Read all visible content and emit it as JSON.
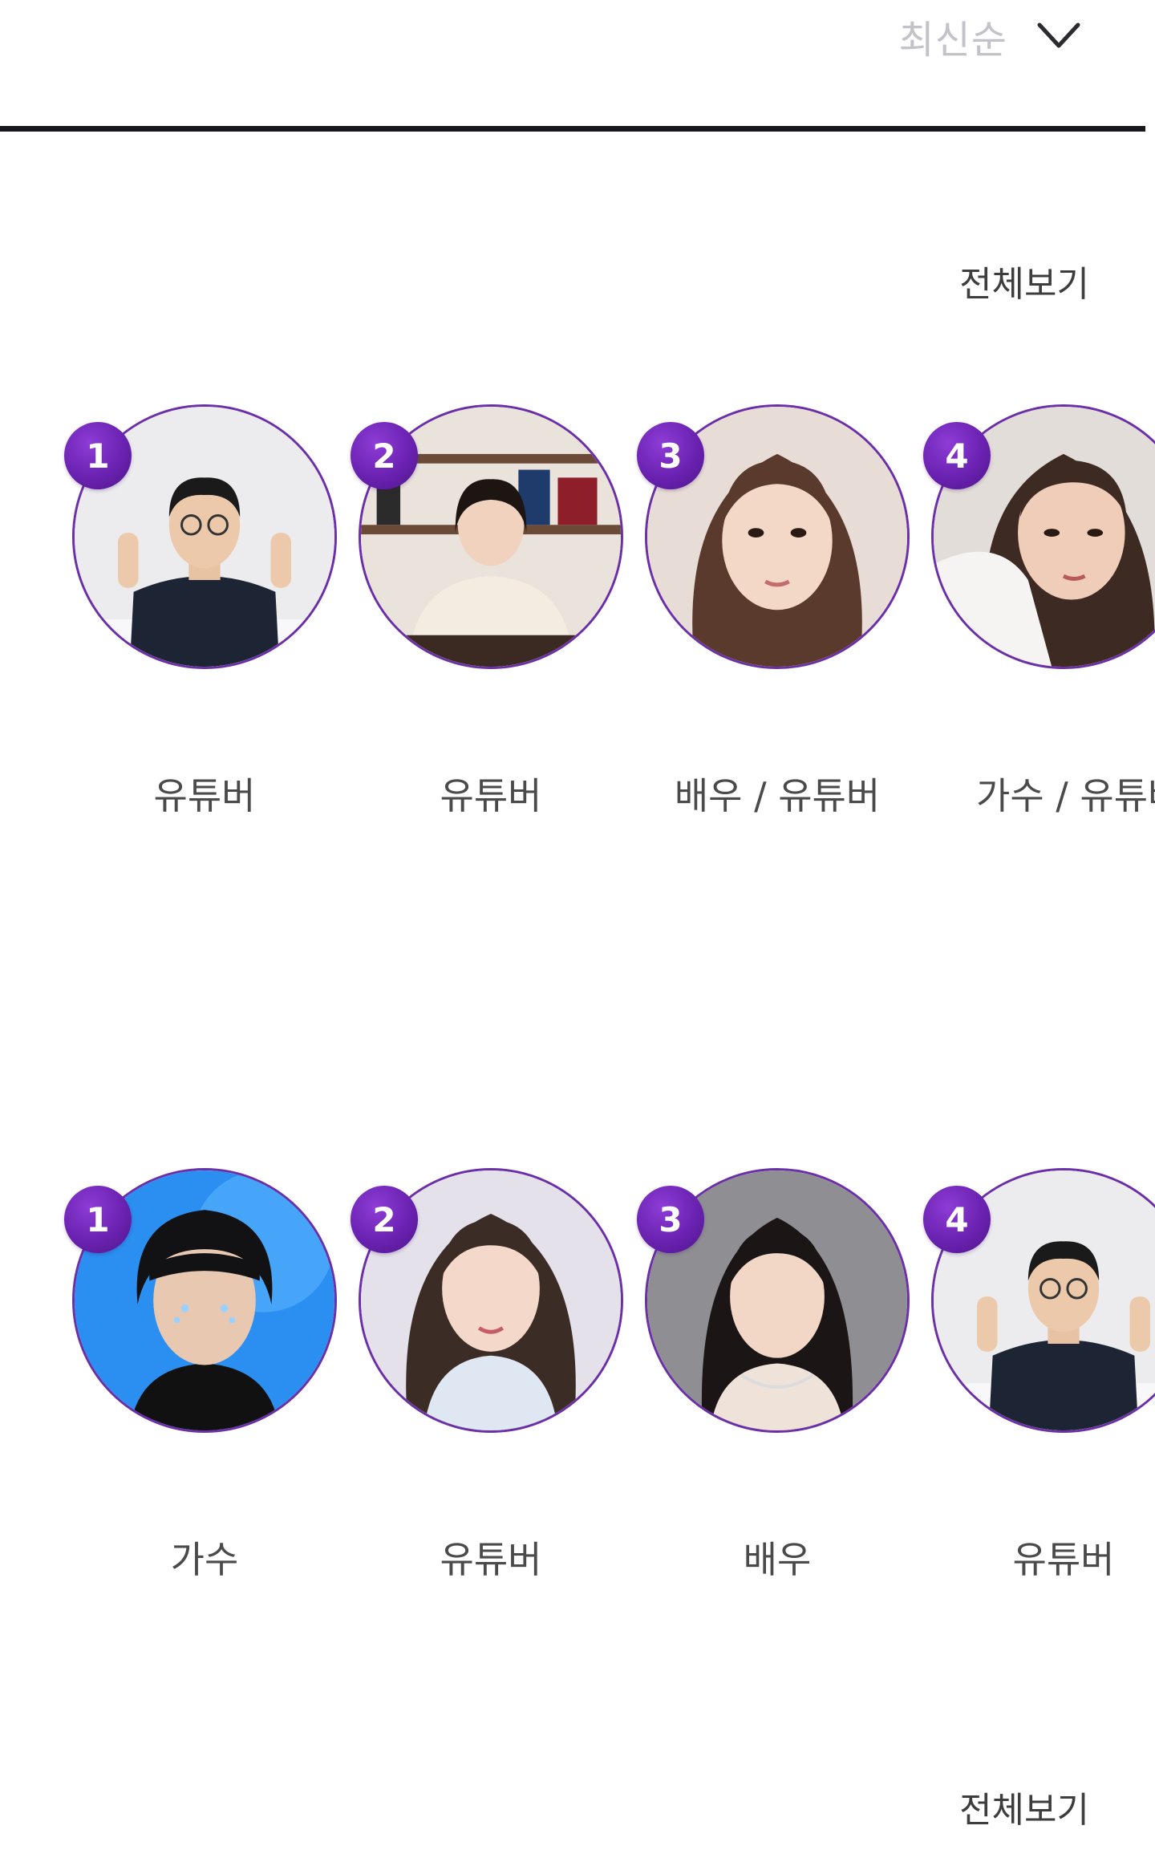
{
  "sort": {
    "label": "최신순",
    "icon": "chevron-down-icon"
  },
  "sections": [
    {
      "view_all": "전체보기",
      "items": [
        {
          "rank": "1",
          "category": "유튜버",
          "photo": "man-glasses-peace-sign"
        },
        {
          "rank": "2",
          "category": "유튜버",
          "photo": "woman-makeup-studio"
        },
        {
          "rank": "3",
          "category": "배우 / 유튜버",
          "photo": "woman-portrait-brown-hair"
        },
        {
          "rank": "4",
          "category": "가수 / 유튜버",
          "photo": "woman-portrait-white-cloth"
        }
      ]
    },
    {
      "view_all": "전체보기",
      "items": [
        {
          "rank": "1",
          "category": "가수",
          "photo": "man-portrait-blue-background"
        },
        {
          "rank": "2",
          "category": "유튜버",
          "photo": "woman-long-hair-shirt"
        },
        {
          "rank": "3",
          "category": "배우",
          "photo": "woman-portrait-necklace"
        },
        {
          "rank": "4",
          "category": "유튜버",
          "photo": "man-glasses-peace-sign"
        }
      ]
    }
  ],
  "colors": {
    "accent": "#6b2fa8",
    "badge": "#6a22b1",
    "divider": "#16161c",
    "sort_text": "#c2c2c8"
  }
}
